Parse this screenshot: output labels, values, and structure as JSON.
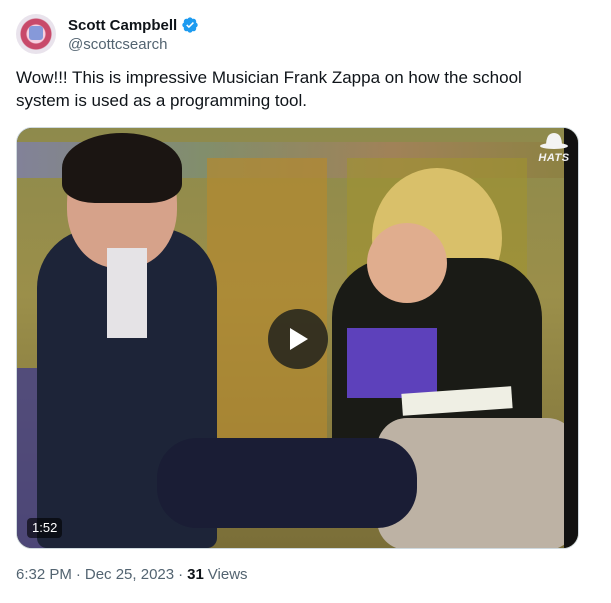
{
  "author": {
    "name": "Scott Campbell",
    "handle": "@scottcsearch",
    "verified_badge_icon": "verified-badge-icon",
    "badge_color": "#1d9bf0"
  },
  "tweet": {
    "text": "Wow!!! This is impressive Musician Frank Zappa on how the school system is used as a programming tool."
  },
  "media": {
    "type": "video",
    "watermark": "HATS",
    "duration": "1:52",
    "play_icon": "play-icon"
  },
  "meta": {
    "time": "6:32 PM",
    "separator": "·",
    "date": "Dec 25, 2023",
    "views_count": "31",
    "views_label": "Views"
  }
}
